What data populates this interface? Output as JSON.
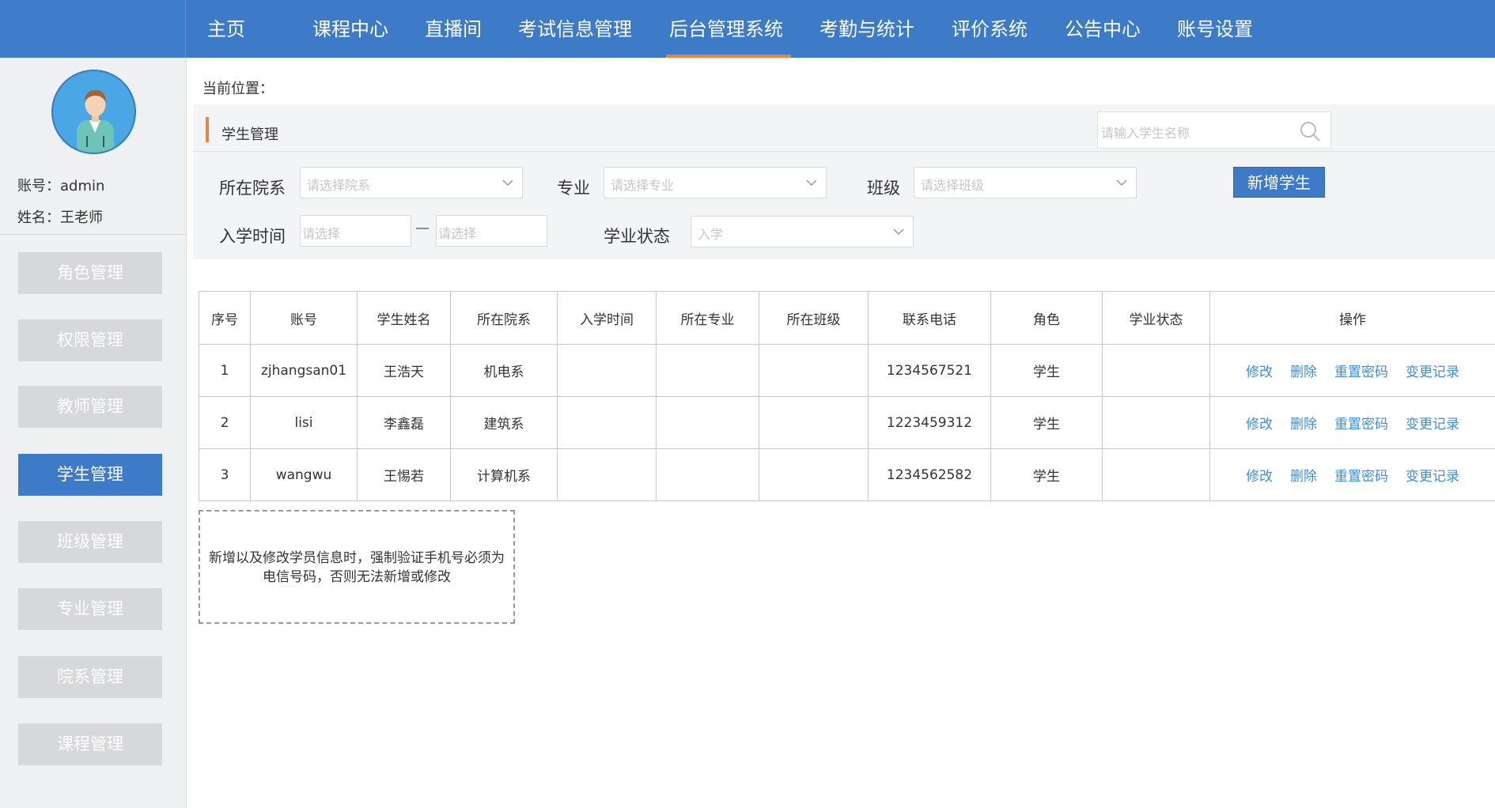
{
  "nav": {
    "items": [
      {
        "label": "主页"
      },
      {
        "label": "课程中心"
      },
      {
        "label": "直播间"
      },
      {
        "label": "考试信息管理"
      },
      {
        "label": "后台管理系统"
      },
      {
        "label": "考勤与统计"
      },
      {
        "label": "评价系统"
      },
      {
        "label": "公告中心"
      },
      {
        "label": "账号设置"
      }
    ],
    "active": "后台管理系统"
  },
  "sidebar": {
    "account_line": "账号：admin",
    "name_line": "姓名：王老师",
    "items": [
      {
        "label": "角色管理"
      },
      {
        "label": "权限管理"
      },
      {
        "label": "教师管理"
      },
      {
        "label": "学生管理"
      },
      {
        "label": "班级管理"
      },
      {
        "label": "专业管理"
      },
      {
        "label": "院系管理"
      },
      {
        "label": "课程管理"
      }
    ],
    "active": "学生管理"
  },
  "breadcrumb": "当前位置：",
  "panel": {
    "title": "学生管理",
    "search_placeholder": "请输入学生名称"
  },
  "filters": {
    "department_label": "所在院系",
    "department_placeholder": "请选择院系",
    "major_label": "专业",
    "major_placeholder": "请选择专业",
    "class_label": "班级",
    "class_placeholder": "请选择班级",
    "enroll_label": "入学时间",
    "enroll_start_placeholder": "请选择",
    "enroll_sep": "—",
    "enroll_end_placeholder": "请选择",
    "status_label": "学业状态",
    "status_value": "入学",
    "add_button": "新增学生"
  },
  "table": {
    "headers": [
      "序号",
      "账号",
      "学生姓名",
      "所在院系",
      "入学时间",
      "所在专业",
      "所在班级",
      "联系电话",
      "角色",
      "学业状态",
      "操作"
    ],
    "rows": [
      {
        "no": "1",
        "account": "zjhangsan01",
        "name": "王浩天",
        "dept": "机电系",
        "enroll": "",
        "major": "",
        "class": "",
        "phone": "1234567521",
        "role": "学生",
        "status": ""
      },
      {
        "no": "2",
        "account": "lisi",
        "name": "李鑫磊",
        "dept": "建筑系",
        "enroll": "",
        "major": "",
        "class": "",
        "phone": "1223459312",
        "role": "学生",
        "status": ""
      },
      {
        "no": "3",
        "account": "wangwu",
        "name": "王惕若",
        "dept": "计算机系",
        "enroll": "",
        "major": "",
        "class": "",
        "phone": "1234562582",
        "role": "学生",
        "status": ""
      }
    ],
    "actions": {
      "edit": "修改",
      "delete": "删除",
      "reset": "重置密码",
      "history": "变更记录"
    }
  },
  "note": "新增以及修改学员信息时，强制验证手机号必须为电信号码，否则无法新增或修改",
  "colors": {
    "primary": "#3d7ac7",
    "accent": "#e9843a",
    "link": "#3d8fdd"
  }
}
